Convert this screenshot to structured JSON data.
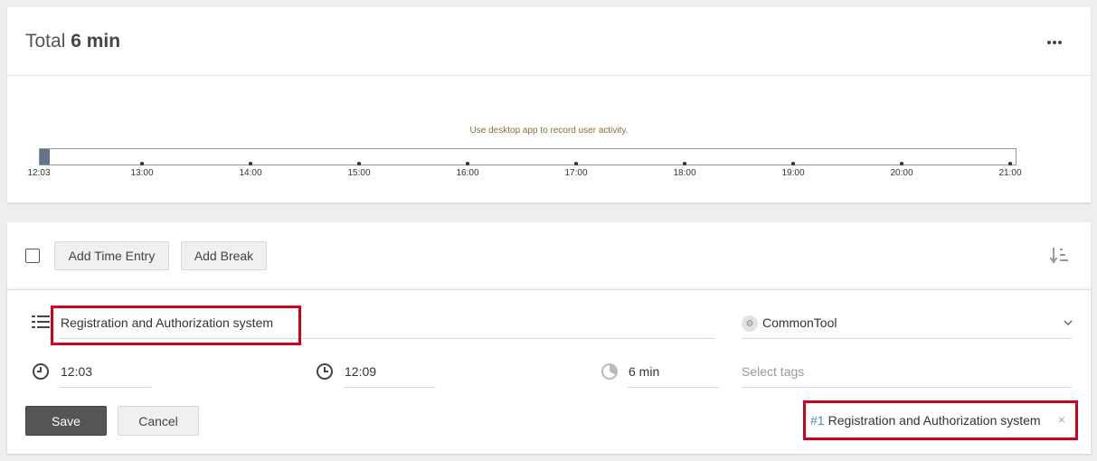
{
  "summary": {
    "total_label": "Total",
    "total_value": "6 min",
    "more_icon": "more-horizontal-icon"
  },
  "timeline": {
    "hint": "Use desktop app to record user activity.",
    "ticks": [
      "12:03",
      "13:00",
      "14:00",
      "15:00",
      "16:00",
      "17:00",
      "18:00",
      "19:00",
      "20:00",
      "21:00"
    ],
    "bar_color": "#66748a"
  },
  "toolbar": {
    "add_time_entry": "Add Time Entry",
    "add_break": "Add Break",
    "sort_icon": "sort-descending-icon"
  },
  "entry": {
    "task_name": "Registration and Authorization system",
    "project": "CommonTool",
    "start_time": "12:03",
    "end_time": "12:09",
    "duration": "6 min",
    "tags_placeholder": "Select tags",
    "tag": {
      "number": "#1",
      "label": "Registration and Authorization system",
      "remove": "×"
    }
  },
  "actions": {
    "save": "Save",
    "cancel": "Cancel"
  },
  "colors": {
    "highlight": "#d0021b",
    "tag_number": "#4a86c5",
    "save_button": "#555555"
  }
}
